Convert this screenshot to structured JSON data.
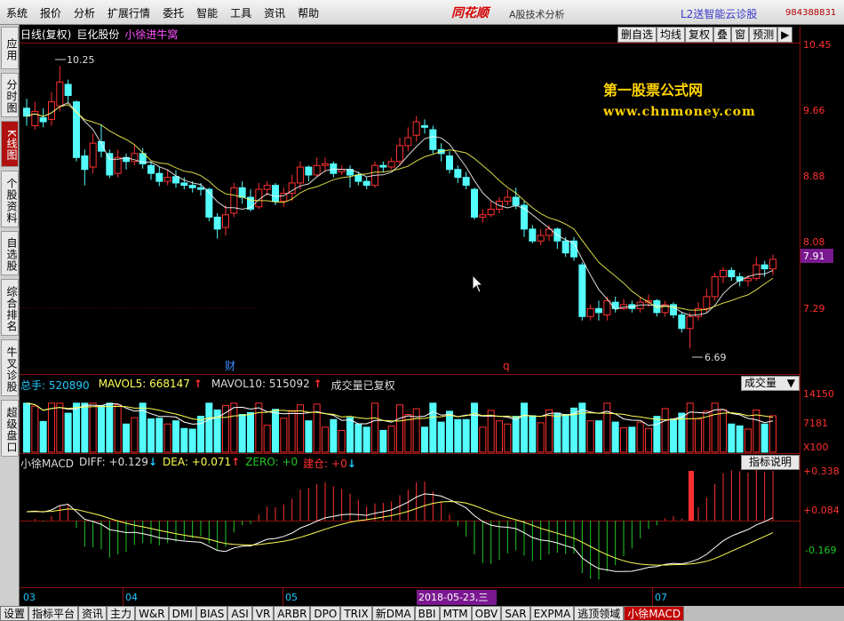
{
  "menu": [
    "系统",
    "报价",
    "分析",
    "扩展行情",
    "委托",
    "智能",
    "工具",
    "资讯",
    "帮助"
  ],
  "brand": "同花顺",
  "brand_sub": "A股技术分析",
  "l2_link": "L2送智能云诊股",
  "phone": "984388831",
  "left_tabs": [
    "应用",
    "分时图",
    "K线图",
    "个股资料",
    "自选股",
    "综合排名",
    "牛叉诊股",
    "超级盘口"
  ],
  "header": {
    "period": "日线(复权)",
    "stock": "巨化股份",
    "formula": "小徐进牛窝"
  },
  "toolbar": [
    "删自选",
    "均线",
    "复权",
    "叠",
    "窗",
    "预测",
    "▶"
  ],
  "watermark": {
    "line1": "第一股票公式网",
    "line2": "www.chnmoney.com"
  },
  "price_axis": [
    "10.45",
    "9.66",
    "8.88",
    "8.08",
    "7.29"
  ],
  "current_price": "7.91",
  "high_label": "10.25",
  "low_label": "6.69",
  "event_marks": [
    {
      "text": "财"
    },
    {
      "text": "q"
    }
  ],
  "volume": {
    "total_label": "总手:",
    "total_value": "520890",
    "mavol5_label": "MAVOL5:",
    "mavol5_value": "668147",
    "mavol10_label": "MAVOL10:",
    "mavol10_value": "515092",
    "note": "成交量已复权",
    "select_value": "成交量",
    "axis": [
      "14150",
      "7181",
      "X100"
    ]
  },
  "macd": {
    "title": "小徐MACD",
    "diff_label": "DIFF:",
    "diff_value": "+0.129",
    "dea_label": "DEA:",
    "dea_value": "+0.071",
    "zero_label": "ZERO:",
    "zero_value": "+0",
    "build_label": "建仓:",
    "build_value": "+0",
    "explain_button": "指标说明",
    "axis": [
      "+0.338",
      "+0.084",
      "-0.169"
    ]
  },
  "x_axis": [
    "03",
    "04",
    "05",
    "07"
  ],
  "cursor_date": "2018-05-23,三",
  "bottom_tabs": [
    "设置",
    "指标平台",
    "资讯",
    "主力",
    "W&R",
    "DMI",
    "BIAS",
    "ASI",
    "VR",
    "ARBR",
    "DPO",
    "TRIX",
    "新DMA",
    "BBI",
    "MTM",
    "OBV",
    "SAR",
    "EXPMA",
    "逃顶领域",
    "小徐MACD"
  ],
  "colors": {
    "up": "#ff3030",
    "down": "#54fcfc",
    "ma_white": "#ffffff",
    "ma_yellow": "#ffff55",
    "macd_green": "#22c822"
  },
  "chart_data": {
    "type": "candlestick",
    "ylim": [
      6.5,
      10.5
    ],
    "candles": [
      [
        9.72,
        9.62,
        9.84,
        9.5
      ],
      [
        9.5,
        9.68,
        9.8,
        9.45
      ],
      [
        9.6,
        9.55,
        9.72,
        9.48
      ],
      [
        9.58,
        9.8,
        9.92,
        9.5
      ],
      [
        9.75,
        10.05,
        10.25,
        9.68
      ],
      [
        10.02,
        9.88,
        10.08,
        9.8
      ],
      [
        9.8,
        9.1,
        9.82,
        9.05
      ],
      [
        9.12,
        8.95,
        9.2,
        8.75
      ],
      [
        8.98,
        9.28,
        9.4,
        8.9
      ],
      [
        9.3,
        9.18,
        9.52,
        9.1
      ],
      [
        9.15,
        8.88,
        9.2,
        8.84
      ],
      [
        8.9,
        9.1,
        9.2,
        8.85
      ],
      [
        9.1,
        9.05,
        9.15,
        8.95
      ],
      [
        9.05,
        9.15,
        9.25,
        9.0
      ],
      [
        9.15,
        9.02,
        9.22,
        8.96
      ],
      [
        9.0,
        8.9,
        9.05,
        8.82
      ],
      [
        8.9,
        8.8,
        8.98,
        8.74
      ],
      [
        8.8,
        8.85,
        8.95,
        8.75
      ],
      [
        8.86,
        8.78,
        8.94,
        8.72
      ],
      [
        8.78,
        8.75,
        8.85,
        8.7
      ],
      [
        8.75,
        8.72,
        8.8,
        8.66
      ],
      [
        8.72,
        8.7,
        8.78,
        8.62
      ],
      [
        8.7,
        8.35,
        8.72,
        8.3
      ],
      [
        8.35,
        8.2,
        8.4,
        8.08
      ],
      [
        8.22,
        8.38,
        8.5,
        8.12
      ],
      [
        8.4,
        8.72,
        8.78,
        8.35
      ],
      [
        8.72,
        8.6,
        8.8,
        8.52
      ],
      [
        8.6,
        8.45,
        8.7,
        8.42
      ],
      [
        8.48,
        8.7,
        8.78,
        8.45
      ],
      [
        8.7,
        8.75,
        8.8,
        8.62
      ],
      [
        8.75,
        8.55,
        8.78,
        8.5
      ],
      [
        8.55,
        8.65,
        8.72,
        8.48
      ],
      [
        8.65,
        8.78,
        8.88,
        8.55
      ],
      [
        8.78,
        8.98,
        9.05,
        8.7
      ],
      [
        8.98,
        8.88,
        9.0,
        8.8
      ],
      [
        8.88,
        9.0,
        9.1,
        8.85
      ],
      [
        9.0,
        9.02,
        9.1,
        8.92
      ],
      [
        9.02,
        8.9,
        9.05,
        8.85
      ],
      [
        8.92,
        8.95,
        9.0,
        8.88
      ],
      [
        8.95,
        8.88,
        9.0,
        8.72
      ],
      [
        8.88,
        8.8,
        8.92,
        8.75
      ],
      [
        8.8,
        8.75,
        8.85,
        8.7
      ],
      [
        8.75,
        9.0,
        9.05,
        8.72
      ],
      [
        9.0,
        8.98,
        9.05,
        8.92
      ],
      [
        8.98,
        9.05,
        9.1,
        8.95
      ],
      [
        9.05,
        9.25,
        9.35,
        9.0
      ],
      [
        9.25,
        9.35,
        9.48,
        9.18
      ],
      [
        9.38,
        9.55,
        9.62,
        9.3
      ],
      [
        9.5,
        9.48,
        9.58,
        9.4
      ],
      [
        9.45,
        9.2,
        9.5,
        9.15
      ],
      [
        9.2,
        9.15,
        9.28,
        9.05
      ],
      [
        9.12,
        8.95,
        9.18,
        8.9
      ],
      [
        8.95,
        8.85,
        9.0,
        8.78
      ],
      [
        8.85,
        8.75,
        8.92,
        8.7
      ],
      [
        8.7,
        8.35,
        8.72,
        8.32
      ],
      [
        8.35,
        8.38,
        8.45,
        8.28
      ],
      [
        8.38,
        8.45,
        8.55,
        8.35
      ],
      [
        8.45,
        8.55,
        8.6,
        8.4
      ],
      [
        8.55,
        8.6,
        8.7,
        8.5
      ],
      [
        8.6,
        8.5,
        8.72,
        8.45
      ],
      [
        8.5,
        8.2,
        8.55,
        8.1
      ],
      [
        8.2,
        8.05,
        8.25,
        8.02
      ],
      [
        8.05,
        8.12,
        8.2,
        8.0
      ],
      [
        8.12,
        8.2,
        8.25,
        8.05
      ],
      [
        8.2,
        8.05,
        8.22,
        7.95
      ],
      [
        8.05,
        7.9,
        8.1,
        7.85
      ],
      [
        8.05,
        7.85,
        8.1,
        7.8
      ],
      [
        7.75,
        7.1,
        7.78,
        7.05
      ],
      [
        7.1,
        7.2,
        7.25,
        7.05
      ],
      [
        7.2,
        7.15,
        7.3,
        7.05
      ],
      [
        7.12,
        7.3,
        7.35,
        7.05
      ],
      [
        7.28,
        7.2,
        7.35,
        7.15
      ],
      [
        7.2,
        7.25,
        7.32,
        7.18
      ],
      [
        7.25,
        7.2,
        7.3,
        7.15
      ],
      [
        7.2,
        7.28,
        7.35,
        7.15
      ],
      [
        7.28,
        7.3,
        7.38,
        7.22
      ],
      [
        7.3,
        7.15,
        7.32,
        7.1
      ],
      [
        7.15,
        7.25,
        7.3,
        7.1
      ],
      [
        7.25,
        7.12,
        7.28,
        7.08
      ],
      [
        7.12,
        6.95,
        7.15,
        6.9
      ],
      [
        6.95,
        7.1,
        7.15,
        6.7
      ],
      [
        7.1,
        7.2,
        7.28,
        7.05
      ],
      [
        7.2,
        7.35,
        7.45,
        7.15
      ],
      [
        7.35,
        7.6,
        7.65,
        7.3
      ],
      [
        7.6,
        7.68,
        7.72,
        7.52
      ],
      [
        7.68,
        7.6,
        7.72,
        7.55
      ],
      [
        7.6,
        7.55,
        7.65,
        7.48
      ],
      [
        7.55,
        7.58,
        7.62,
        7.48
      ],
      [
        7.58,
        7.75,
        7.85,
        7.55
      ],
      [
        7.75,
        7.7,
        7.8,
        7.6
      ],
      [
        7.7,
        7.82,
        7.88,
        7.62
      ]
    ]
  }
}
